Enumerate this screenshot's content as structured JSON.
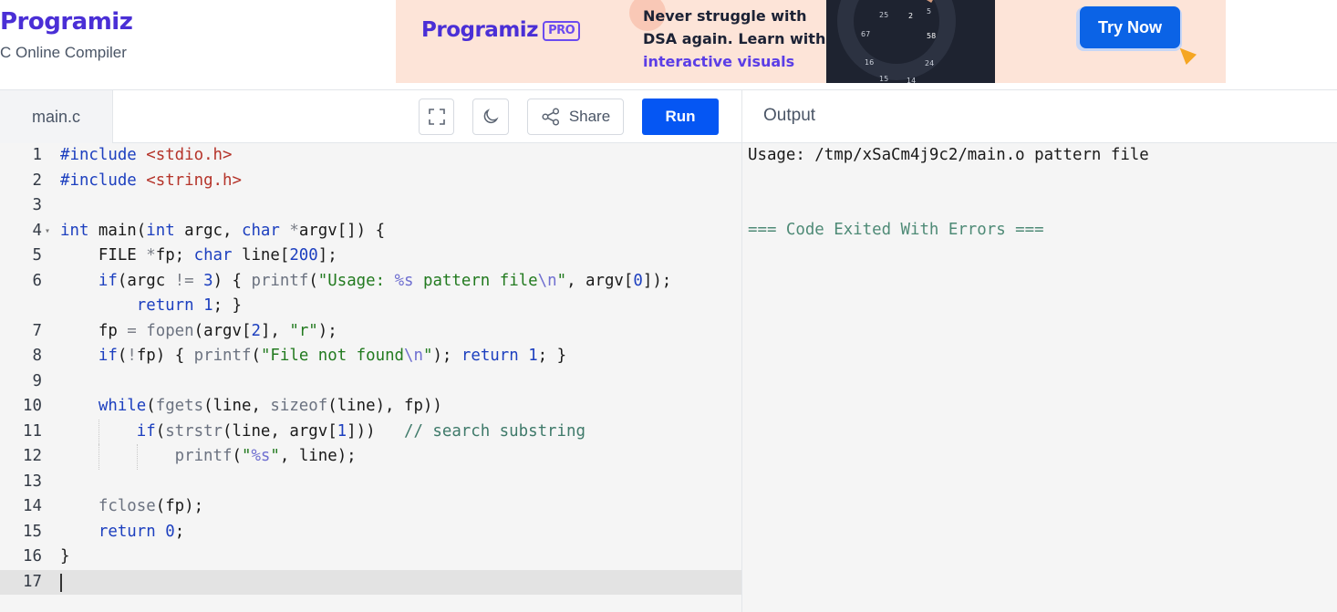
{
  "header": {
    "logo": "Programiz",
    "subtitle": "C Online Compiler"
  },
  "banner": {
    "logo": "Programiz",
    "pro_tag": "PRO",
    "line1": "Never struggle with",
    "line2": "DSA again. Learn with",
    "line3": "interactive visuals",
    "cta": "Try Now",
    "wheel_numbers": [
      "25",
      "2",
      "5",
      "67",
      "58",
      "16",
      "24",
      "15",
      "14"
    ]
  },
  "toolbar": {
    "file_tab": "main.c",
    "share_label": "Share",
    "run_label": "Run"
  },
  "output": {
    "title": "Output",
    "lines": [
      "Usage: /tmp/xSaCm4j9c2/main.o pattern file",
      "=== Code Exited With Errors ==="
    ]
  },
  "editor": {
    "line_numbers": [
      "1",
      "2",
      "3",
      "4",
      "5",
      "6",
      "",
      "7",
      "8",
      "9",
      "10",
      "11",
      "12",
      "13",
      "14",
      "15",
      "16",
      "17"
    ],
    "active_line": "17"
  },
  "colors": {
    "run_button": "#0556f3",
    "try_now_button": "#0b63e6",
    "brand_purple": "#4a2fd6",
    "banner_bg": "#fde4d8",
    "error_text": "#4e8a76"
  }
}
